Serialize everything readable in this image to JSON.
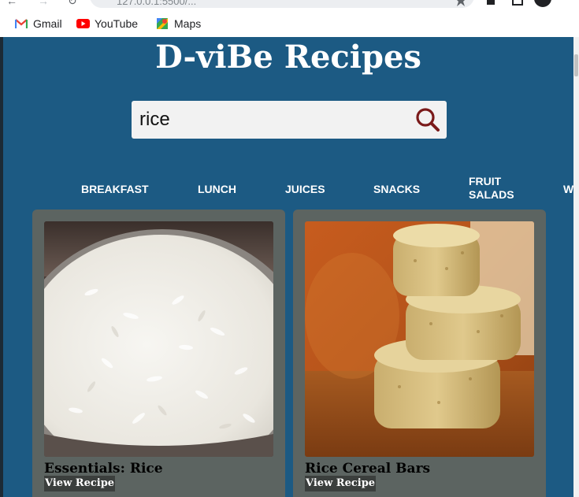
{
  "browser": {
    "url": "127.0.0.1:5500/..."
  },
  "bookmarks": [
    {
      "label": "Gmail",
      "icon": "gmail-icon"
    },
    {
      "label": "YouTube",
      "icon": "youtube-icon"
    },
    {
      "label": "Maps",
      "icon": "maps-icon"
    }
  ],
  "page": {
    "title": "D-viBe Recipes",
    "search_value": "rice",
    "categories": [
      "BREAKFAST",
      "LUNCH",
      "JUICES",
      "SNACKS",
      "FRUIT\nSALADS",
      "W"
    ],
    "cards": [
      {
        "title": "Essentials: Rice",
        "button": "View Recipe"
      },
      {
        "title": "Rice Cereal Bars",
        "button": "View Recipe"
      }
    ]
  },
  "colors": {
    "page_bg": "#1c5a83",
    "card_bg": "#5c6461",
    "search_icon": "#7a1a1a"
  }
}
